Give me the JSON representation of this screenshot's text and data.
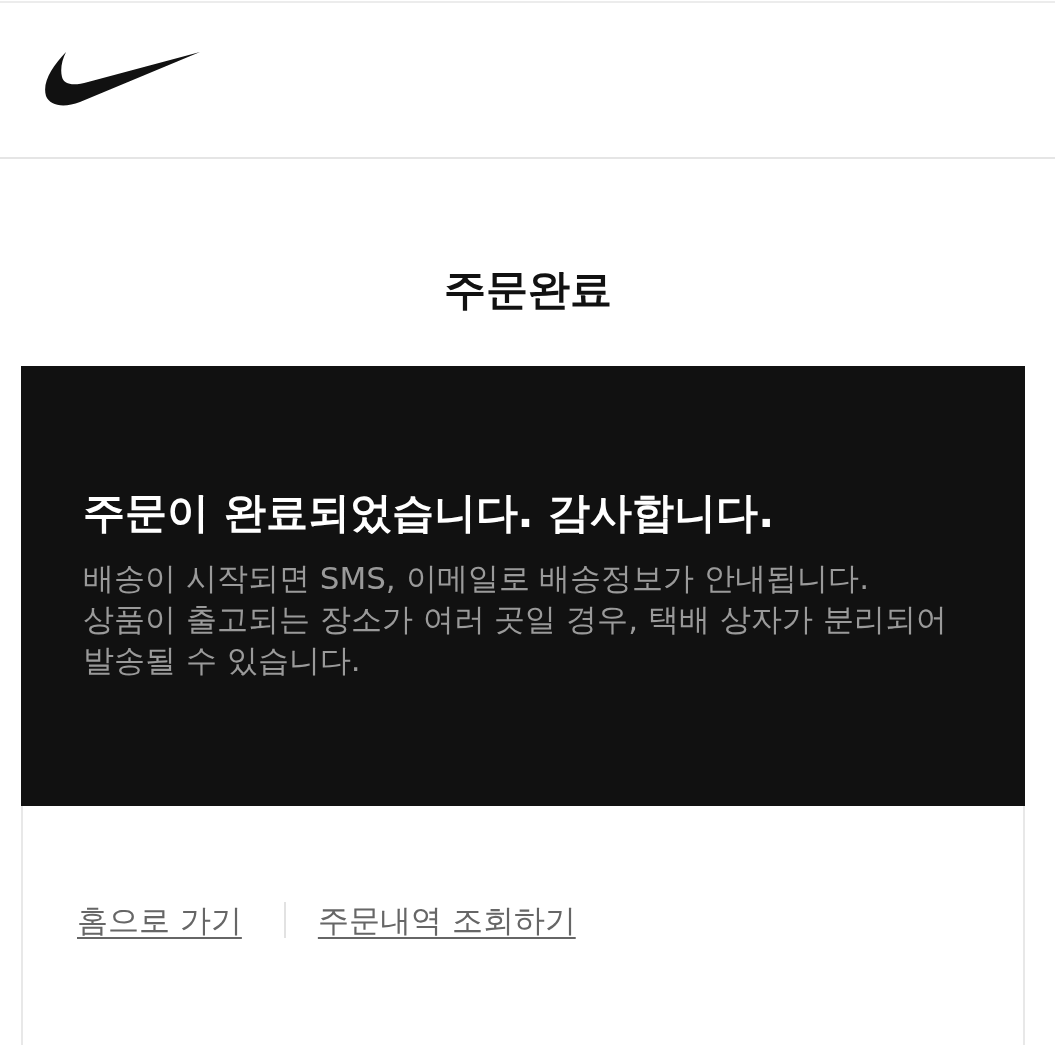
{
  "page_title": "주문완료",
  "notice": {
    "heading": "주문이 완료되었습니다. 감사합니다.",
    "lines": [
      "배송이 시작되면 SMS, 이메일로 배송정보가 안내됩니다.",
      "상품이 출고되는 장소가 여러 곳일 경우, 택배 상자가 분리되어 발송될 수 있습니다."
    ]
  },
  "links": [
    {
      "label": "홈으로 가기"
    },
    {
      "label": "주문내역 조회하기"
    }
  ]
}
